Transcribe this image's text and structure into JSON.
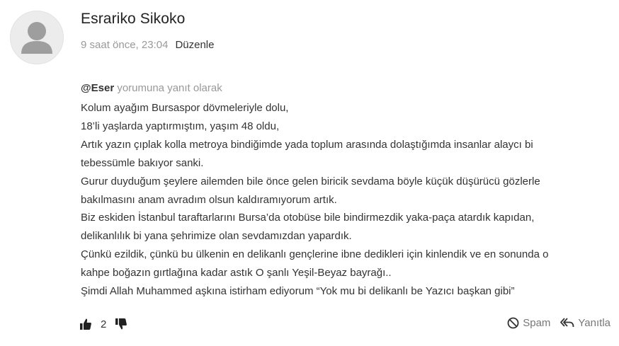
{
  "comment": {
    "author": "Esrariko Sikoko",
    "time": "9 saat önce, 23:04",
    "edit_label": "Düzenle",
    "reply_mention": "@Eser",
    "reply_suffix": " yorumuna yanıt olarak",
    "lines": [
      "Kolum ayağım Bursaspor dövmeleriyle dolu,",
      "18’li yaşlarda yaptırmıştım, yaşım 48 oldu,",
      "Artık yazın çıplak kolla metroya bindiğimde yada toplum arasında dolaştığımda insanlar alaycı bi",
      "tebessümle bakıyor sanki.",
      "Gurur duyduğum şeylere ailemden bile önce gelen biricik sevdama böyle küçük düşürücü gözlerle",
      "bakılmasını anam avradım olsun kaldıramıyorum artık.",
      "Biz eskiden İstanbul taraftarlarını Bursa’da otobüse bile bindirmezdik yaka-paça atardık kapıdan,",
      "delikanlılık bi yana şehrimize olan sevdamızdan yapardık.",
      "Çünkü ezildik, çünkü bu ülkenin en delikanlı gençlerine ibne dedikleri için kinlendik ve en sonunda o",
      "kahpe boğazın gırtlağına kadar astık O şanlı Yeşil-Beyaz bayrağı..",
      "Şimdi Allah Muhammed aşkına istirham ediyorum “Yok mu bi delikanlı be Yazıcı başkan gibi”"
    ],
    "like_count": "2",
    "spam_label": "Spam",
    "reply_label": "Yanıtla"
  },
  "icons": {
    "avatar": "user-silhouette-icon",
    "like": "thumbs-up-icon",
    "dislike": "thumbs-down-icon",
    "spam": "block-icon",
    "reply": "reply-arrow-icon"
  }
}
